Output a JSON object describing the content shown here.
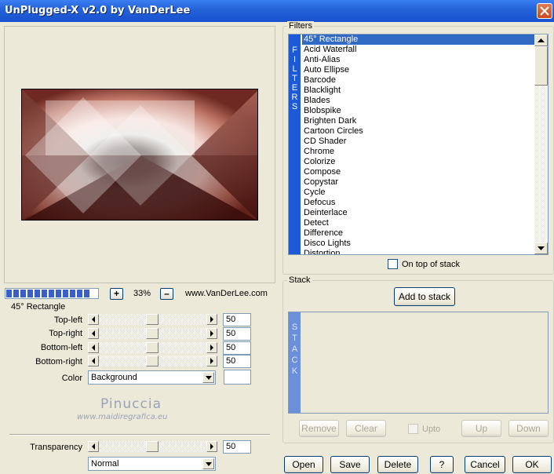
{
  "window": {
    "title": "UnPlugged-X v2.0 by VanDerLee"
  },
  "preview": {
    "zoom": "33%",
    "zoom_minus": "–",
    "zoom_plus": "+",
    "website": "www.VanDerLee.com",
    "progress_segments": 12
  },
  "filter_settings": {
    "group_label": "45° Rectangle",
    "sliders": [
      {
        "label": "Top-left",
        "value": "50"
      },
      {
        "label": "Top-right",
        "value": "50"
      },
      {
        "label": "Bottom-left",
        "value": "50"
      },
      {
        "label": "Bottom-right",
        "value": "50"
      }
    ],
    "color_label": "Color",
    "color_value": "Background"
  },
  "watermark": {
    "name": "Pinuccia",
    "url": "www.maidiregrafica.eu"
  },
  "transparency": {
    "label": "Transparency",
    "value": "50",
    "blend_mode": "Normal"
  },
  "filters": {
    "group_label": "Filters",
    "side_letters": [
      "F",
      "I",
      "L",
      "T",
      "E",
      "R",
      "S"
    ],
    "items": [
      "45° Rectangle",
      "Acid Waterfall",
      "Anti-Alias",
      "Auto Ellipse",
      "Barcode",
      "Blacklight",
      "Blades",
      "Blobspike",
      "Brighten Dark",
      "Cartoon Circles",
      "CD Shader",
      "Chrome",
      "Colorize",
      "Compose",
      "Copystar",
      "Cycle",
      "Defocus",
      "Deinterlace",
      "Detect",
      "Difference",
      "Disco Lights",
      "Distortion"
    ],
    "selected_index": 0,
    "on_top_label": "On top of stack"
  },
  "stack": {
    "group_label": "Stack",
    "add_label": "Add to stack",
    "side_letters": [
      "S",
      "T",
      "A",
      "C",
      "K"
    ],
    "remove_label": "Remove",
    "clear_label": "Clear",
    "upto_label": "Upto",
    "up_label": "Up",
    "down_label": "Down"
  },
  "footer": {
    "open_label": "Open",
    "save_label": "Save",
    "delete_label": "Delete",
    "help_label": "?",
    "cancel_label": "Cancel",
    "ok_label": "OK"
  },
  "colors": {
    "title_bar": "#2563d8",
    "list_selection": "#316ac5",
    "filters_strip": "#1f5ad6",
    "stack_strip": "#6b8fd8"
  }
}
